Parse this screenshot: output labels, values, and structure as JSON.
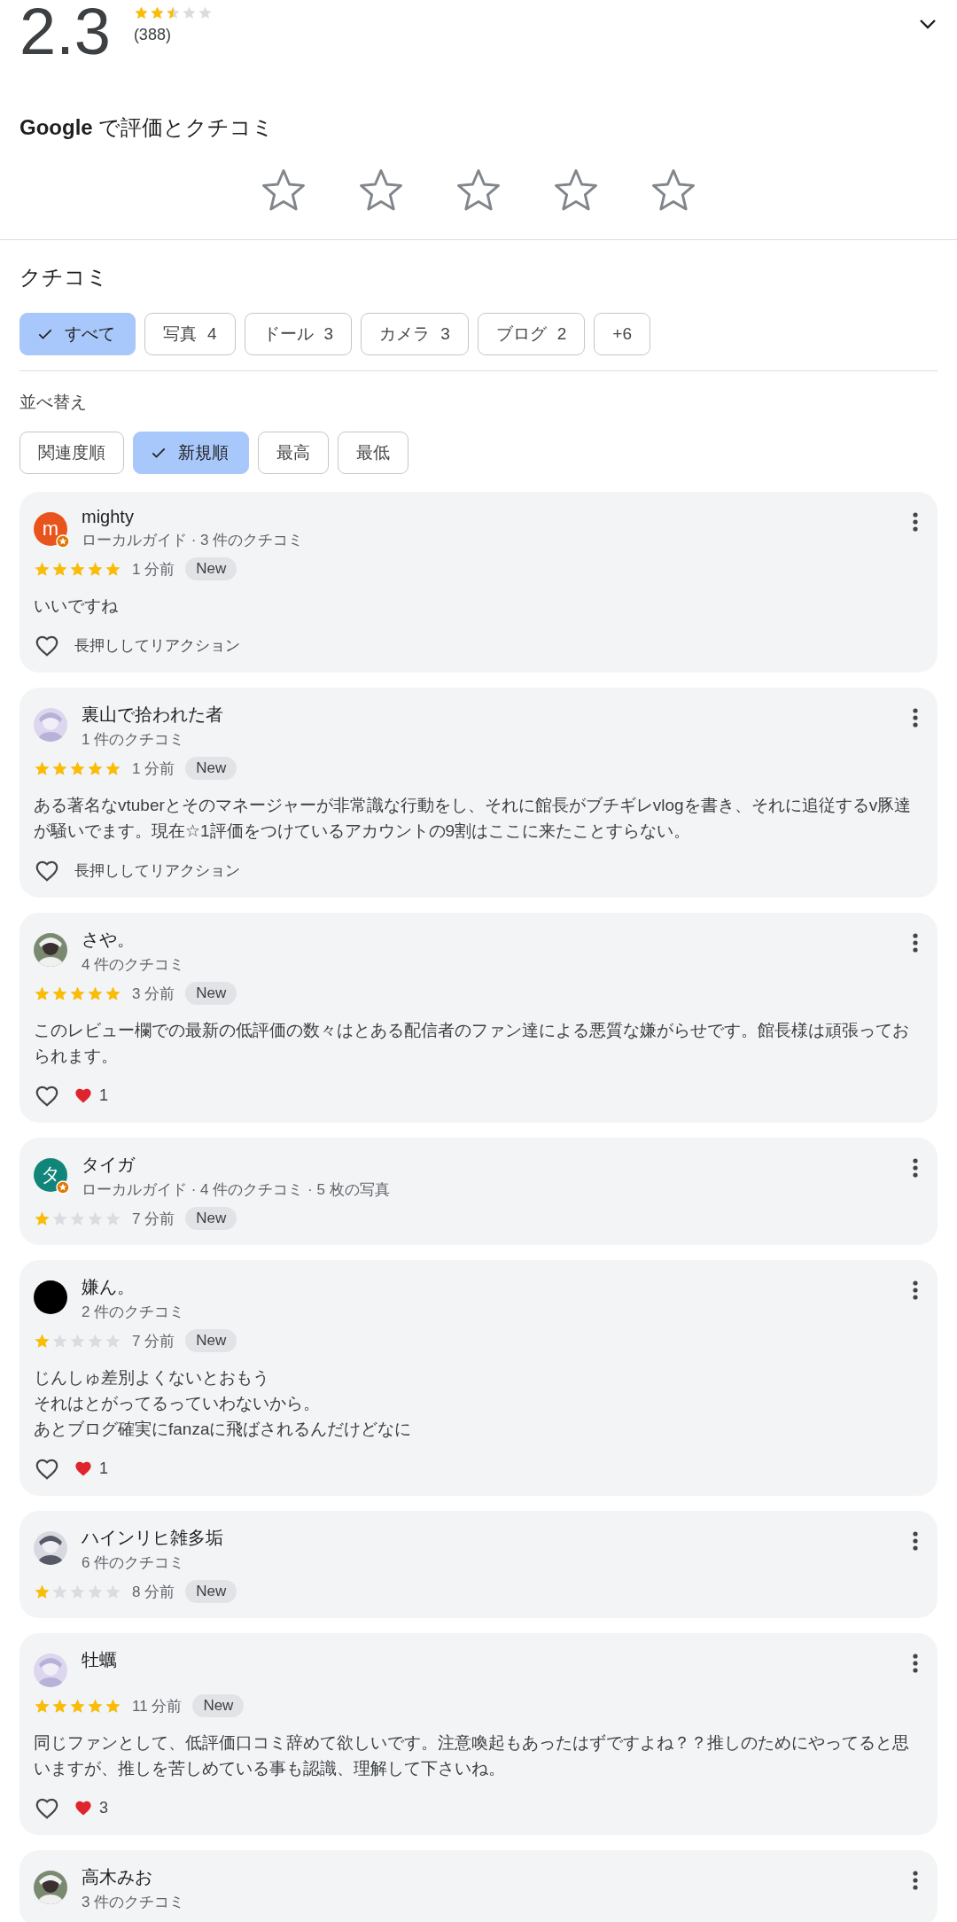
{
  "summary": {
    "score": "2.3",
    "stars": 2.5,
    "count": "(388)"
  },
  "rate": {
    "title_brand": "Google",
    "title_rest": "で評価とクチコミ",
    "stars": 0
  },
  "reviews_heading": "クチコミ",
  "filters": [
    {
      "label": "すべて",
      "selected": true
    },
    {
      "label": "写真",
      "count": "4",
      "selected": false
    },
    {
      "label": "ドール",
      "count": "3",
      "selected": false
    },
    {
      "label": "カメラ",
      "count": "3",
      "selected": false
    },
    {
      "label": "ブログ",
      "count": "2",
      "selected": false
    },
    {
      "label": "+6",
      "selected": false
    }
  ],
  "sort_heading": "並べ替え",
  "sorts": [
    {
      "label": "関連度順",
      "selected": false
    },
    {
      "label": "新規順",
      "selected": true
    },
    {
      "label": "最高",
      "selected": false
    },
    {
      "label": "最低",
      "selected": false
    }
  ],
  "reviews": [
    {
      "name": "mighty",
      "avatar": {
        "kind": "letter",
        "letter": "m",
        "color": "#e8541c"
      },
      "local_guide": true,
      "subtitle": "ローカルガイド · 3 件のクチコミ",
      "stars": 5,
      "time": "1 分前",
      "badge": "New",
      "text": "いいですね",
      "reaction": {
        "kind": "prompt",
        "text": "長押ししてリアクション"
      }
    },
    {
      "name": "裏山で拾われた者",
      "subtitle": "1 件のクチコミ",
      "stars": 5,
      "time": "1 分前",
      "badge": "New",
      "text": "ある著名なvtuberとそのマネージャーが非常識な行動をし、それに館長がブチギレvlogを書き、それに追従するv豚達が騒いでます。現在☆1評価をつけているアカウントの9割はここに来たことすらない。",
      "reaction": {
        "kind": "prompt",
        "text": "長押ししてリアクション"
      }
    },
    {
      "name": "さや。",
      "subtitle": "4 件のクチコミ",
      "stars": 5,
      "time": "3 分前",
      "badge": "New",
      "text": "このレビュー欄での最新の低評価の数々はとある配信者のファン達による悪質な嫌がらせです。館長様は頑張っておられます。",
      "reaction": {
        "kind": "count",
        "text": "1"
      }
    },
    {
      "name": "タイガ",
      "avatar": {
        "kind": "letter",
        "letter": "タ",
        "color": "#12857a"
      },
      "local_guide": true,
      "subtitle": "ローカルガイド · 4 件のクチコミ · 5 枚の写真",
      "stars": 1,
      "time": "7 分前",
      "badge": "New"
    },
    {
      "name": "嫌ん。",
      "avatar": {
        "kind": "plain",
        "color": "#000000"
      },
      "subtitle": "2 件のクチコミ",
      "stars": 1,
      "time": "7 分前",
      "badge": "New",
      "lines": [
        "じんしゅ差別よくないとおもう",
        "それはとがってるっていわないから。",
        "あとブログ確実にfanzaに飛ばされるんだけどなに"
      ],
      "reaction": {
        "kind": "count",
        "text": "1"
      }
    },
    {
      "name": "ハインリヒ雑多垢",
      "subtitle": "6 件のクチコミ",
      "stars": 1,
      "time": "8 分前",
      "badge": "New"
    },
    {
      "name": "牡蠣",
      "stars": 5,
      "time": "11 分前",
      "badge": "New",
      "text": "同じファンとして、低評価口コミ辞めて欲しいです。注意喚起もあったはずですよね？？推しのためにやってると思いますが、推しを苦しめている事も認識、理解して下さいね。",
      "reaction": {
        "kind": "count",
        "text": "3"
      }
    },
    {
      "name": "高木みお",
      "subtitle": "3 件のクチコミ"
    }
  ]
}
